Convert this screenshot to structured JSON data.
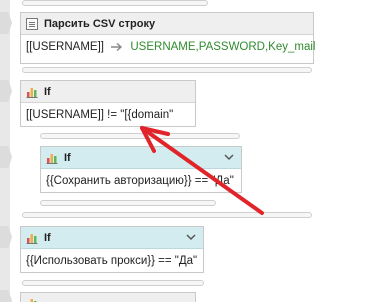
{
  "blocks": {
    "csv": {
      "title": "Парсить CSV строку",
      "source": "[[USERNAME]]",
      "targets": "USERNAME,PASSWORD,Key_mail"
    },
    "if1": {
      "title": "If",
      "condition": "[[USERNAME]] != \"[{domain\""
    },
    "if2": {
      "title": "If",
      "condition": "{{Сохранить авторизацию}} == \"Да\""
    },
    "if3": {
      "title": "If",
      "condition": "{{Использовать прокси}} == \"Да\""
    }
  },
  "icons": {
    "csv": "csv-table-icon",
    "if": "bar-chart-icon",
    "arrow": "right-arrow-icon",
    "chevron": "chevron-down-icon"
  },
  "colors": {
    "condition_header": "#d3ecef",
    "target_text": "#2e8b2e",
    "annotation_arrow": "#e0242a"
  }
}
